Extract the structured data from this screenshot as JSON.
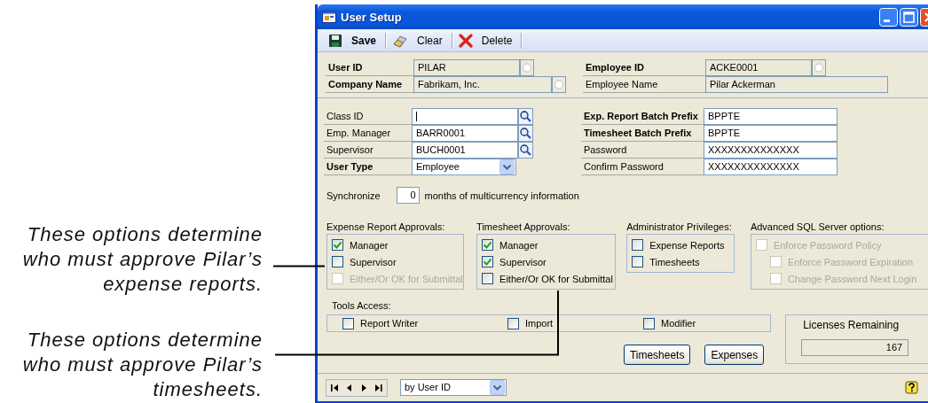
{
  "callouts": [
    {
      "text": "These options determine who must approve Pilar’s expense reports."
    },
    {
      "text": "These options determine who must approve Pilar’s timesheets."
    }
  ],
  "window": {
    "title": "User Setup"
  },
  "toolbar": [
    {
      "label": "Save",
      "bold": true
    },
    {
      "label": "Clear",
      "bold": false
    },
    {
      "label": "Delete",
      "bold": false
    }
  ],
  "header": {
    "left": [
      {
        "label": "User ID",
        "value": "PILAR",
        "required": true,
        "editable": false,
        "kind": "circle"
      },
      {
        "label": "Company Name",
        "value": "Fabrikam, Inc.",
        "required": true,
        "editable": false,
        "kind": "circle"
      }
    ],
    "right": [
      {
        "label": "Employee ID",
        "value": "ACKE0001",
        "required": true,
        "editable": false,
        "kind": "circle"
      },
      {
        "label": "Employee Name",
        "value": "Pilar Ackerman",
        "required": false,
        "editable": false
      }
    ]
  },
  "details": {
    "left": [
      {
        "label": "Class ID",
        "focused": true,
        "required": false,
        "editable": true,
        "kind": "lookup"
      },
      {
        "label": "Emp. Manager",
        "value": "BARR0001",
        "focused": false,
        "required": false,
        "editable": true,
        "kind": "lookup"
      },
      {
        "label": "Supervisor",
        "value": "BUCH0001",
        "focused": false,
        "required": false,
        "editable": true,
        "kind": "lookup"
      },
      {
        "label": "User Type",
        "value": "Employee",
        "focused": false,
        "required": true,
        "editable": true,
        "kind": "dropdown"
      }
    ],
    "right": [
      {
        "label": "Exp. Report Batch Prefix",
        "value": "BPPTE",
        "required": true,
        "editable": true
      },
      {
        "label": "Timesheet Batch Prefix",
        "value": "BPPTE",
        "required": true,
        "editable": true
      },
      {
        "label": "Password",
        "value": "XXXXXXXXXXXXXX",
        "required": false,
        "editable": true
      },
      {
        "label": "Confirm Password",
        "value": "XXXXXXXXXXXXXX",
        "required": false,
        "editable": true
      }
    ]
  },
  "synchronize": {
    "label": "Synchronize",
    "value": "0",
    "suffix": "months of multicurrency information"
  },
  "groups": [
    {
      "title": "Expense Report Approvals:",
      "options": [
        {
          "label": "Manager",
          "checked": true,
          "disabled": false
        },
        {
          "label": "Supervisor",
          "checked": false,
          "disabled": false
        },
        {
          "label": "Either/Or OK for Submittal",
          "checked": false,
          "disabled": true
        }
      ]
    },
    {
      "title": "Timesheet Approvals:",
      "options": [
        {
          "label": "Manager",
          "checked": true,
          "disabled": false
        },
        {
          "label": "Supervisor",
          "checked": true,
          "disabled": false
        },
        {
          "label": "Either/Or OK for Submittal",
          "checked": false,
          "disabled": false
        }
      ]
    },
    {
      "title": "Administrator Privileges:",
      "options": [
        {
          "label": "Expense Reports",
          "checked": false,
          "disabled": false
        },
        {
          "label": "Timesheets",
          "checked": false,
          "disabled": false
        }
      ]
    },
    {
      "title": "Advanced SQL Server options:",
      "options": [
        {
          "label": "Enforce Password Policy",
          "checked": false,
          "disabled": true,
          "children": [
            {
              "label": "Enforce Password Expiration",
              "checked": false,
              "disabled": true
            },
            {
              "label": "Change Password Next Login",
              "checked": false,
              "disabled": true
            }
          ]
        }
      ]
    }
  ],
  "tools_access": {
    "title": "Tools Access:",
    "options": [
      {
        "label": "Report Writer",
        "checked": false,
        "disabled": false
      },
      {
        "label": "Import",
        "checked": false,
        "disabled": false
      },
      {
        "label": "Modifier",
        "checked": false,
        "disabled": false
      }
    ]
  },
  "licenses": {
    "title": "Licenses Remaining",
    "value": "167"
  },
  "buttons": [
    "Timesheets",
    "Expenses"
  ],
  "footer": {
    "sort": "by User ID"
  }
}
